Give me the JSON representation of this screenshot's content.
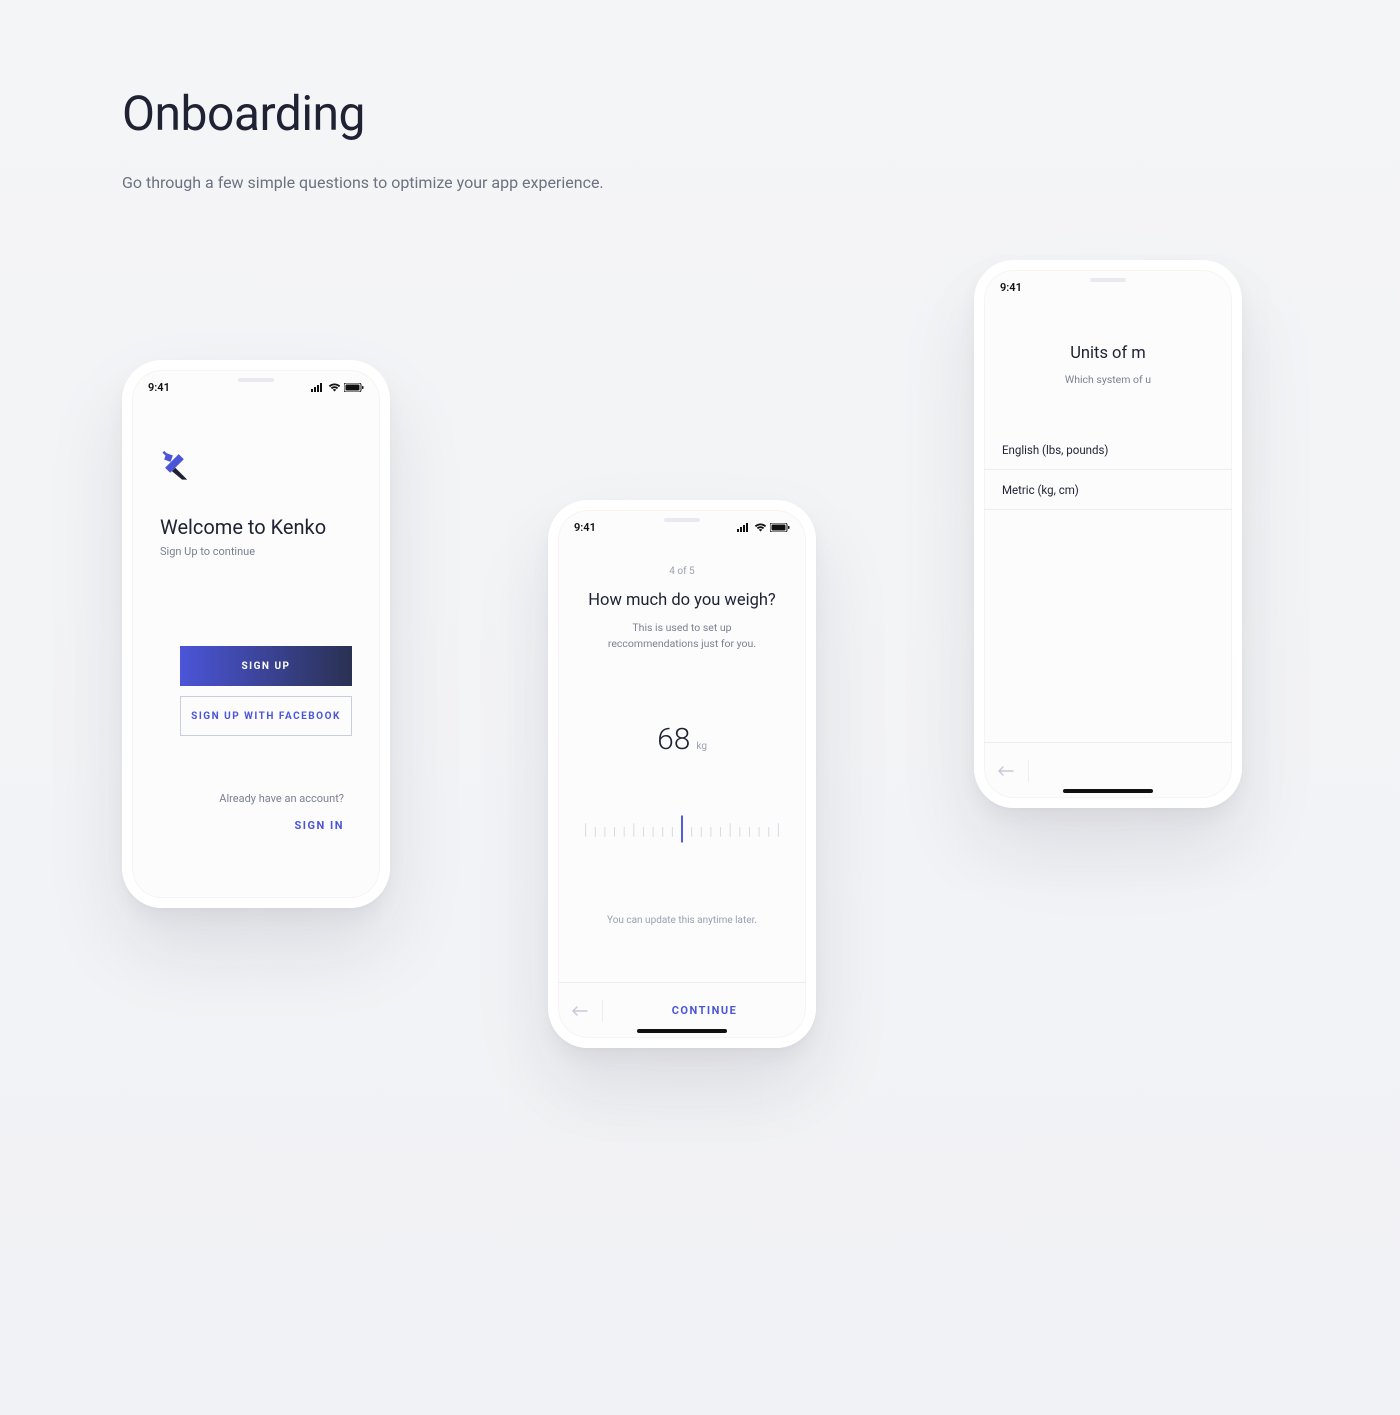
{
  "header": {
    "title": "Onboarding",
    "subtitle": "Go through a few simple questions to optimize your app experience."
  },
  "status": {
    "time": "9:41"
  },
  "phone1": {
    "welcome_title": "Welcome to Kenko",
    "welcome_sub": "Sign Up to continue",
    "signup_label": "SIGN UP",
    "signup_fb_label": "SIGN UP WITH FACEBOOK",
    "already_text": "Already have an account?",
    "signin_label": "SIGN IN"
  },
  "phone2": {
    "step": "4 of 5",
    "title": "How much do you weigh?",
    "subtitle": "This is used to set up reccommendations just for you.",
    "weight_value": "68",
    "weight_unit": "kg",
    "update_note": "You can update this anytime later.",
    "continue_label": "CONTINUE"
  },
  "phone3": {
    "title": "Units of m",
    "subtitle": "Which system of u",
    "options": [
      "English (lbs, pounds)",
      "Metric (kg, cm)"
    ]
  },
  "colors": {
    "accent": "#4b55d8",
    "text_primary": "#1e2233",
    "text_muted": "#7b8191"
  }
}
